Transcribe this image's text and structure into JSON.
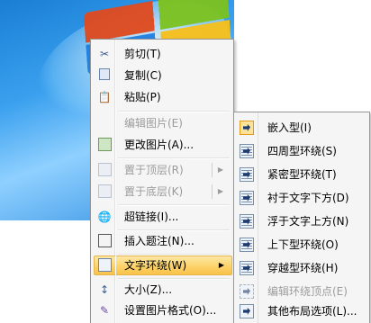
{
  "main_menu": {
    "items": [
      {
        "label": "剪切(T)",
        "icon": "scissors-icon",
        "enabled": true
      },
      {
        "label": "复制(C)",
        "icon": "copy-icon",
        "enabled": true
      },
      {
        "label": "粘贴(P)",
        "icon": "paste-icon",
        "enabled": true
      },
      {
        "label": "编辑图片(E)",
        "icon": "",
        "enabled": false
      },
      {
        "label": "更改图片(A)...",
        "icon": "change-picture-icon",
        "enabled": true
      },
      {
        "label": "置于顶层(R)",
        "icon": "bring-to-front-icon",
        "enabled": false,
        "submenu": true
      },
      {
        "label": "置于底层(K)",
        "icon": "send-to-back-icon",
        "enabled": false,
        "submenu": true
      },
      {
        "label": "超链接(I)...",
        "icon": "hyperlink-globe-icon",
        "enabled": true
      },
      {
        "label": "插入题注(N)...",
        "icon": "insert-caption-icon",
        "enabled": true
      },
      {
        "label": "文字环绕(W)",
        "icon": "text-wrap-icon",
        "enabled": true,
        "submenu": true,
        "highlighted": true
      },
      {
        "label": "大小(Z)...",
        "icon": "size-icon",
        "enabled": true
      },
      {
        "label": "设置图片格式(O)...",
        "icon": "format-picture-icon",
        "enabled": true
      }
    ]
  },
  "wrap_submenu": {
    "items": [
      {
        "label": "嵌入型(I)",
        "icon": "wrap-inline-icon",
        "selected": true
      },
      {
        "label": "四周型环绕(S)",
        "icon": "wrap-square-icon"
      },
      {
        "label": "紧密型环绕(T)",
        "icon": "wrap-tight-icon"
      },
      {
        "label": "衬于文字下方(D)",
        "icon": "wrap-behind-text-icon"
      },
      {
        "label": "浮于文字上方(N)",
        "icon": "wrap-in-front-icon"
      },
      {
        "label": "上下型环绕(O)",
        "icon": "wrap-top-bottom-icon"
      },
      {
        "label": "穿越型环绕(H)",
        "icon": "wrap-through-icon"
      },
      {
        "label": "编辑环绕顶点(E)",
        "icon": "edit-wrap-points-icon",
        "enabled": false
      },
      {
        "label": "其他布局选项(L)...",
        "icon": "more-layout-options-icon"
      }
    ]
  }
}
